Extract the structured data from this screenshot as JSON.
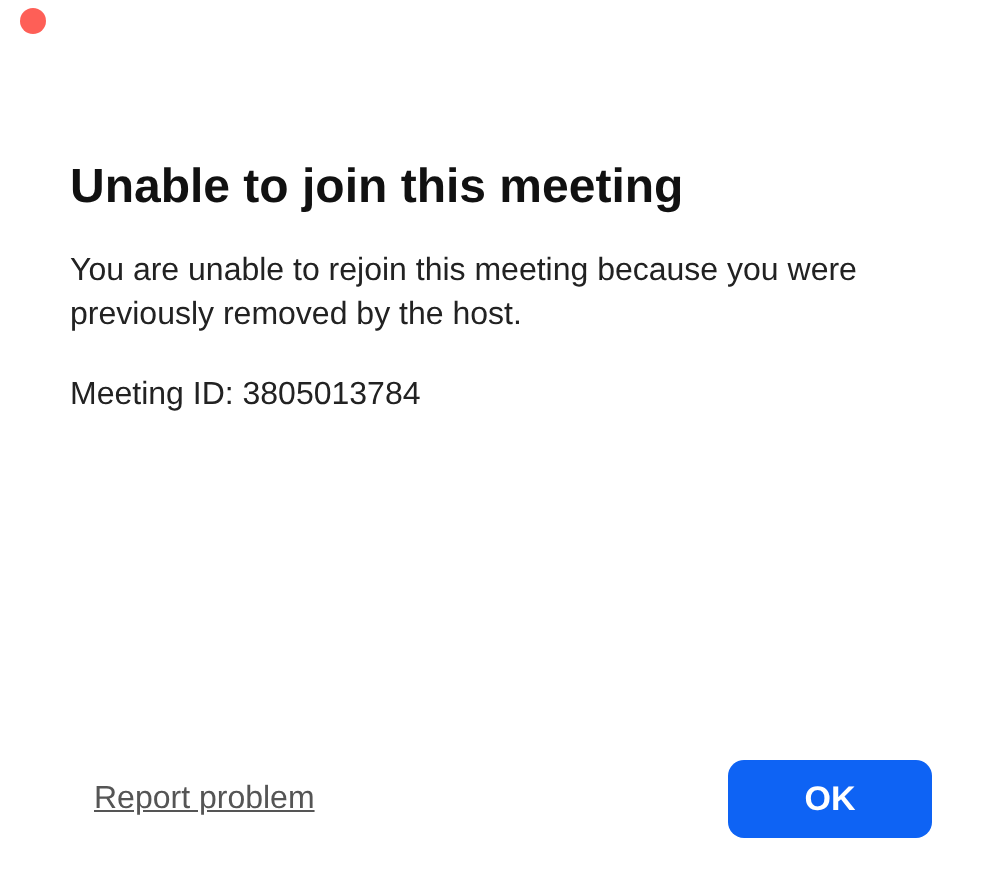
{
  "dialog": {
    "title": "Unable to join this meeting",
    "message": "You are unable to rejoin this meeting because you were previously removed by the host.",
    "meeting_id": "Meeting ID: 3805013784",
    "link": "Report problem",
    "button": "OK"
  }
}
